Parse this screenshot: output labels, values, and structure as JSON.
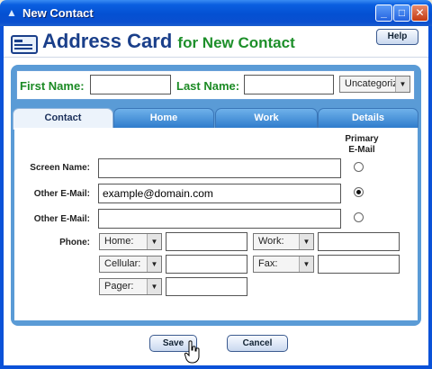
{
  "window": {
    "title": "New Contact"
  },
  "header": {
    "title": "Address Card",
    "subtitle": "for New Contact",
    "help_label": "Help"
  },
  "name_bar": {
    "first_name_label": "First Name:",
    "first_name_value": "",
    "last_name_label": "Last Name:",
    "last_name_value": "",
    "category_value": "Uncategorize"
  },
  "tabs": [
    {
      "label": "Contact",
      "active": true
    },
    {
      "label": "Home",
      "active": false
    },
    {
      "label": "Work",
      "active": false
    },
    {
      "label": "Details",
      "active": false
    }
  ],
  "contact": {
    "primary_header_1": "Primary",
    "primary_header_2": "E-Mail",
    "screen_name_label": "Screen Name:",
    "screen_name_value": "",
    "other_email_1_label": "Other E-Mail:",
    "other_email_1_value": "example@domain.com",
    "other_email_2_label": "Other E-Mail:",
    "other_email_2_value": "",
    "phone_label": "Phone:",
    "phones": [
      {
        "type": "Home:",
        "value": ""
      },
      {
        "type": "Work:",
        "value": ""
      },
      {
        "type": "Cellular:",
        "value": ""
      },
      {
        "type": "Fax:",
        "value": ""
      },
      {
        "type": "Pager:",
        "value": ""
      }
    ]
  },
  "footer": {
    "save_label": "Save",
    "cancel_label": "Cancel"
  },
  "colors": {
    "accent_blue": "#5a9bd6",
    "title_bar": "#0a52d8",
    "name_green": "#1b8a24",
    "header_blue": "#1a3f8a"
  }
}
